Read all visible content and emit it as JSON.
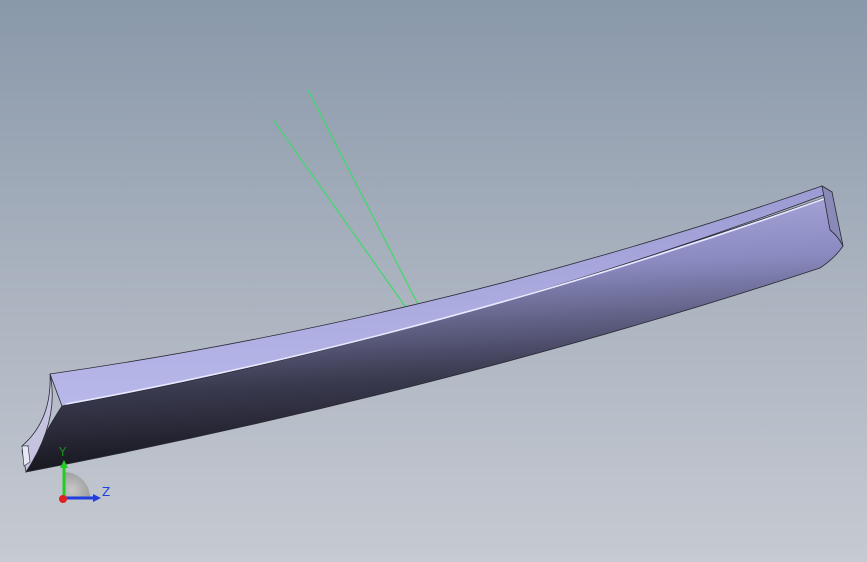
{
  "viewport": {
    "background_top": "#8998aa",
    "background_bottom": "#c6cad2"
  },
  "model": {
    "face_color": "#a9a9dc",
    "shadow_color": "#1c1c24",
    "edge_color": "#2a2a35"
  },
  "sketch_lines": {
    "color": "#3fd96a"
  },
  "triad": {
    "y_label": "Y",
    "z_label": "Z",
    "y_color": "#22cc22",
    "z_color": "#1f3fe0",
    "x_color": "#e02020"
  }
}
